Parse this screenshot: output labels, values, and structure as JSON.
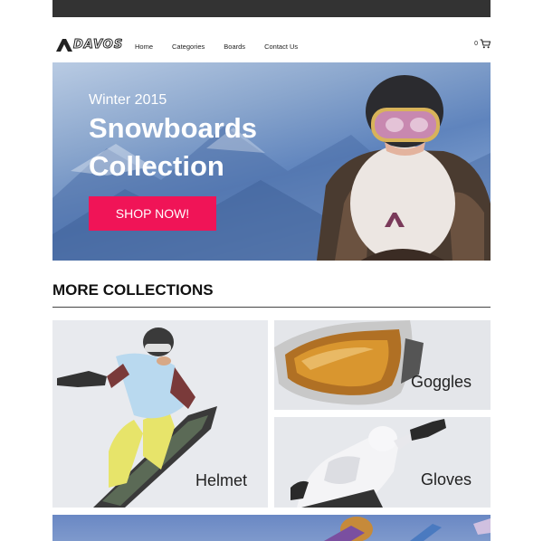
{
  "brand": {
    "name": "DAVOS",
    "icon": "logo-triangle-icon"
  },
  "nav": {
    "links": [
      "Home",
      "Categories",
      "Boards",
      "Contact Us"
    ],
    "cart_count": "0",
    "cart_icon": "cart-icon"
  },
  "hero": {
    "eyebrow": "Winter 2015",
    "title_line1": "Snowboards",
    "title_line2": "Collection",
    "cta": "SHOP NOW!",
    "cta_color": "#f01457"
  },
  "collections": {
    "title": "MORE COLLECTIONS",
    "tiles": [
      {
        "label": "Helmet"
      },
      {
        "label": "Goggles"
      },
      {
        "label": "Gloves"
      }
    ]
  }
}
